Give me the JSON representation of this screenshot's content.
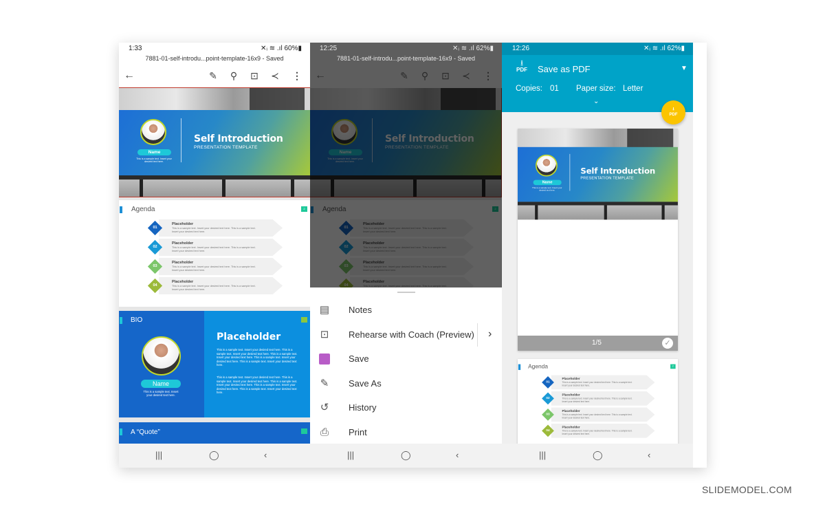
{
  "watermark": "SLIDEMODEL.COM",
  "slides": {
    "hero": {
      "title": "Self Introduction",
      "subtitle": "PRESENTATION TEMPLATE",
      "name": "Name",
      "caption": "This is a sample text. Insert your desired text here."
    },
    "agenda": {
      "title": "Agenda",
      "page_badge": "2",
      "items": [
        {
          "num": "01",
          "title": "Placeholder",
          "text": "This is a sample text. Insert your desired text here. This is a sample text. Insert your desired text here.",
          "color": "#1565c0"
        },
        {
          "num": "02",
          "title": "Placeholder",
          "text": "This is a sample text. Insert your desired text here. This is a sample text. Insert your desired text here.",
          "color": "#1a9ad6"
        },
        {
          "num": "03",
          "title": "Placeholder",
          "text": "This is a sample text. Insert your desired text here. This is a sample text. Insert your desired text here.",
          "color": "#7cc66a"
        },
        {
          "num": "04",
          "title": "Placeholder",
          "text": "This is a sample text. Insert your desired text here. This is a sample text. Insert your desired text here.",
          "color": "#9cba3a"
        }
      ]
    },
    "bio": {
      "title": "BIO",
      "heading": "Placeholder",
      "name": "Name",
      "caption": "This is a sample text. Insert your desired text here.",
      "paragraph1": "This is a sample text. Insert your desired text here. This is a sample text. Insert your desired text here. This is a sample text. Insert your desired text here. This is a sample text. Insert your desired text here. This is a sample text. Insert your desired text here.",
      "paragraph2": "This is a sample text. Insert your desired text here. This is a sample text. Insert your desired text here. This is a sample text. Insert your desired text here. This is a sample text. Insert your desired text here. This is a sample text. Insert your desired text here."
    },
    "quote": {
      "title": "A “Quote”"
    }
  },
  "phone1": {
    "time": "1:33",
    "battery": "60%",
    "doc_title": "7881-01-self-introdu...point-template-16x9 - Saved"
  },
  "phone2": {
    "time": "12:25",
    "battery": "62%",
    "doc_title": "7881-01-self-introdu...point-template-16x9 - Saved",
    "menu": [
      {
        "label": "Notes",
        "icon": "notes-icon"
      },
      {
        "label": "Rehearse with Coach (Preview)",
        "icon": "rehearse-icon"
      },
      {
        "label": "Save",
        "icon": "save-icon"
      },
      {
        "label": "Save As",
        "icon": "save-as-icon"
      },
      {
        "label": "History",
        "icon": "history-icon"
      },
      {
        "label": "Print",
        "icon": "print-icon"
      }
    ]
  },
  "phone3": {
    "time": "12:26",
    "battery": "62%",
    "printer": "Save as PDF",
    "copies_label": "Copies:",
    "copies": "01",
    "paper_label": "Paper size:",
    "paper": "Letter",
    "page_counter": "1/5",
    "fab_label": "PDF",
    "pdf_icon_label": "PDF",
    "accent": "#00a3c8",
    "fab_color": "#fbc400"
  }
}
